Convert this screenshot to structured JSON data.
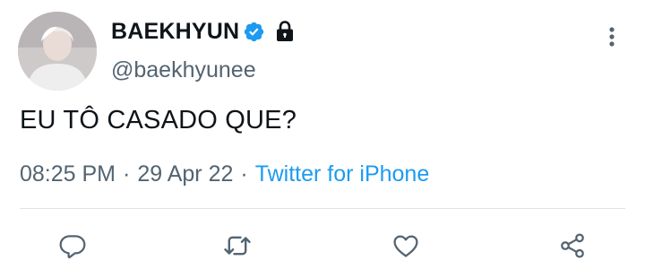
{
  "author": {
    "display_name": "BAEKHYUN",
    "handle": "@baekhyunee",
    "verified": true,
    "protected": true,
    "avatar_icon": "profile-photo"
  },
  "tweet": {
    "text": "EU TÔ CASADO QUE?",
    "time": "08:25 PM",
    "date": "29 Apr 22",
    "separator": "·",
    "source": "Twitter for iPhone"
  },
  "actions": [
    {
      "icon": "reply-icon"
    },
    {
      "icon": "retweet-icon"
    },
    {
      "icon": "like-icon"
    },
    {
      "icon": "share-icon"
    }
  ],
  "colors": {
    "text": "#0f1419",
    "secondary": "#536471",
    "accent": "#1d9bf0",
    "divider": "#dfe3e6"
  }
}
